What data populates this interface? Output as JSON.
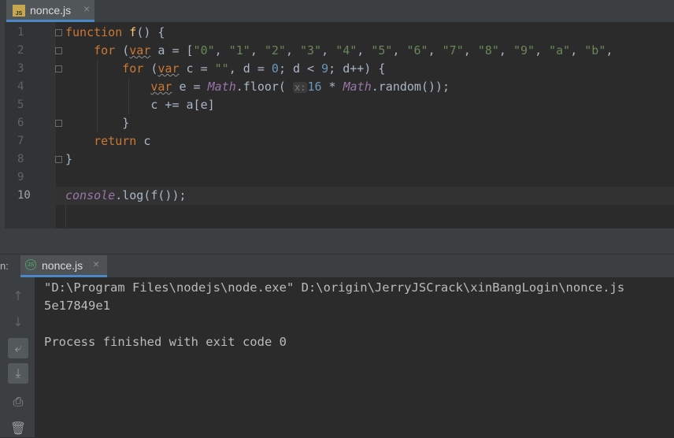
{
  "editor": {
    "tab": {
      "name": "nonce.js",
      "icon": "js-file-icon",
      "close": "×"
    },
    "lines": [
      {
        "n": "1"
      },
      {
        "n": "2"
      },
      {
        "n": "3"
      },
      {
        "n": "4"
      },
      {
        "n": "5"
      },
      {
        "n": "6"
      },
      {
        "n": "7"
      },
      {
        "n": "8"
      },
      {
        "n": "9"
      },
      {
        "n": "10"
      }
    ],
    "code": {
      "l1_kw": "function",
      "l1_fn": "f",
      "l1_rest": "() {",
      "l2_kw": "for",
      "l2_p": " (",
      "l2_var": "var",
      "l2_rest": " a = [",
      "l2_strs": [
        "\"0\"",
        "\"1\"",
        "\"2\"",
        "\"3\"",
        "\"4\"",
        "\"5\"",
        "\"6\"",
        "\"7\"",
        "\"8\"",
        "\"9\"",
        "\"a\"",
        "\"b\""
      ],
      "l3_kw": "for",
      "l3_var": "var",
      "l3_a": " c = ",
      "l3_str": "\"\"",
      "l3_b": ", d = ",
      "l3_n0": "0",
      "l3_c": "; d < ",
      "l3_n9": "9",
      "l3_d": "; d++) {",
      "l4_var": "var",
      "l4_a": " e = ",
      "l4_math": "Math",
      "l4_floor": ".floor(",
      "l4_hint": "x:",
      "l4_n16": "16",
      "l4_b": " * ",
      "l4_math2": "Math",
      "l4_random": ".random());",
      "l5": "c += a[e]",
      "l6": "}",
      "l7_kw": "return",
      "l7_rest": " c",
      "l8": "}",
      "l10_console": "console",
      "l10_rest": ".log(f());"
    }
  },
  "run": {
    "label": "n:",
    "tab": {
      "name": "nonce.js",
      "icon": "nodejs-icon",
      "close": "×"
    },
    "output": [
      "\"D:\\Program Files\\nodejs\\node.exe\" D:\\origin\\JerryJSCrack\\xinBangLogin\\nonce.js",
      "5e17849e1",
      "",
      "Process finished with exit code 0"
    ],
    "tools": [
      {
        "name": "scroll-up-icon",
        "glyph": "↑"
      },
      {
        "name": "scroll-down-icon",
        "glyph": "↓"
      },
      {
        "name": "soft-wrap-icon",
        "glyph": "⤶"
      },
      {
        "name": "scroll-to-end-icon",
        "glyph": "⤓"
      },
      {
        "name": "print-icon",
        "glyph": "⎙"
      },
      {
        "name": "clear-all-icon",
        "glyph": "🗑"
      }
    ]
  },
  "colors": {
    "keyword": "#cc7832",
    "string": "#6a8759",
    "number": "#6897bb",
    "function": "#ffc66d",
    "global": "#9876aa",
    "text": "#a9b7c6"
  }
}
